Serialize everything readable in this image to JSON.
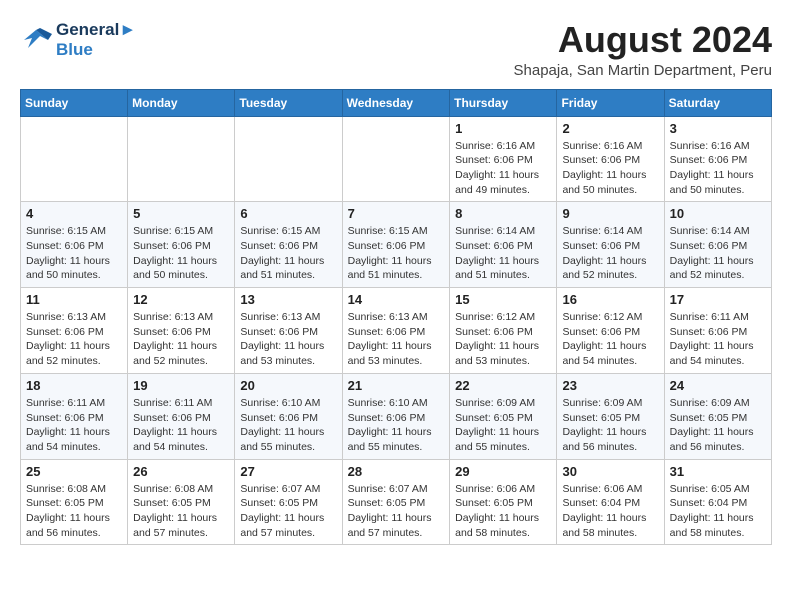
{
  "logo": {
    "line1": "General",
    "line2": "Blue"
  },
  "title": "August 2024",
  "location": "Shapaja, San Martin Department, Peru",
  "days_of_week": [
    "Sunday",
    "Monday",
    "Tuesday",
    "Wednesday",
    "Thursday",
    "Friday",
    "Saturday"
  ],
  "weeks": [
    [
      {
        "day": "",
        "info": ""
      },
      {
        "day": "",
        "info": ""
      },
      {
        "day": "",
        "info": ""
      },
      {
        "day": "",
        "info": ""
      },
      {
        "day": "1",
        "info": "Sunrise: 6:16 AM\nSunset: 6:06 PM\nDaylight: 11 hours and 49 minutes."
      },
      {
        "day": "2",
        "info": "Sunrise: 6:16 AM\nSunset: 6:06 PM\nDaylight: 11 hours and 50 minutes."
      },
      {
        "day": "3",
        "info": "Sunrise: 6:16 AM\nSunset: 6:06 PM\nDaylight: 11 hours and 50 minutes."
      }
    ],
    [
      {
        "day": "4",
        "info": "Sunrise: 6:15 AM\nSunset: 6:06 PM\nDaylight: 11 hours and 50 minutes."
      },
      {
        "day": "5",
        "info": "Sunrise: 6:15 AM\nSunset: 6:06 PM\nDaylight: 11 hours and 50 minutes."
      },
      {
        "day": "6",
        "info": "Sunrise: 6:15 AM\nSunset: 6:06 PM\nDaylight: 11 hours and 51 minutes."
      },
      {
        "day": "7",
        "info": "Sunrise: 6:15 AM\nSunset: 6:06 PM\nDaylight: 11 hours and 51 minutes."
      },
      {
        "day": "8",
        "info": "Sunrise: 6:14 AM\nSunset: 6:06 PM\nDaylight: 11 hours and 51 minutes."
      },
      {
        "day": "9",
        "info": "Sunrise: 6:14 AM\nSunset: 6:06 PM\nDaylight: 11 hours and 52 minutes."
      },
      {
        "day": "10",
        "info": "Sunrise: 6:14 AM\nSunset: 6:06 PM\nDaylight: 11 hours and 52 minutes."
      }
    ],
    [
      {
        "day": "11",
        "info": "Sunrise: 6:13 AM\nSunset: 6:06 PM\nDaylight: 11 hours and 52 minutes."
      },
      {
        "day": "12",
        "info": "Sunrise: 6:13 AM\nSunset: 6:06 PM\nDaylight: 11 hours and 52 minutes."
      },
      {
        "day": "13",
        "info": "Sunrise: 6:13 AM\nSunset: 6:06 PM\nDaylight: 11 hours and 53 minutes."
      },
      {
        "day": "14",
        "info": "Sunrise: 6:13 AM\nSunset: 6:06 PM\nDaylight: 11 hours and 53 minutes."
      },
      {
        "day": "15",
        "info": "Sunrise: 6:12 AM\nSunset: 6:06 PM\nDaylight: 11 hours and 53 minutes."
      },
      {
        "day": "16",
        "info": "Sunrise: 6:12 AM\nSunset: 6:06 PM\nDaylight: 11 hours and 54 minutes."
      },
      {
        "day": "17",
        "info": "Sunrise: 6:11 AM\nSunset: 6:06 PM\nDaylight: 11 hours and 54 minutes."
      }
    ],
    [
      {
        "day": "18",
        "info": "Sunrise: 6:11 AM\nSunset: 6:06 PM\nDaylight: 11 hours and 54 minutes."
      },
      {
        "day": "19",
        "info": "Sunrise: 6:11 AM\nSunset: 6:06 PM\nDaylight: 11 hours and 54 minutes."
      },
      {
        "day": "20",
        "info": "Sunrise: 6:10 AM\nSunset: 6:06 PM\nDaylight: 11 hours and 55 minutes."
      },
      {
        "day": "21",
        "info": "Sunrise: 6:10 AM\nSunset: 6:06 PM\nDaylight: 11 hours and 55 minutes."
      },
      {
        "day": "22",
        "info": "Sunrise: 6:09 AM\nSunset: 6:05 PM\nDaylight: 11 hours and 55 minutes."
      },
      {
        "day": "23",
        "info": "Sunrise: 6:09 AM\nSunset: 6:05 PM\nDaylight: 11 hours and 56 minutes."
      },
      {
        "day": "24",
        "info": "Sunrise: 6:09 AM\nSunset: 6:05 PM\nDaylight: 11 hours and 56 minutes."
      }
    ],
    [
      {
        "day": "25",
        "info": "Sunrise: 6:08 AM\nSunset: 6:05 PM\nDaylight: 11 hours and 56 minutes."
      },
      {
        "day": "26",
        "info": "Sunrise: 6:08 AM\nSunset: 6:05 PM\nDaylight: 11 hours and 57 minutes."
      },
      {
        "day": "27",
        "info": "Sunrise: 6:07 AM\nSunset: 6:05 PM\nDaylight: 11 hours and 57 minutes."
      },
      {
        "day": "28",
        "info": "Sunrise: 6:07 AM\nSunset: 6:05 PM\nDaylight: 11 hours and 57 minutes."
      },
      {
        "day": "29",
        "info": "Sunrise: 6:06 AM\nSunset: 6:05 PM\nDaylight: 11 hours and 58 minutes."
      },
      {
        "day": "30",
        "info": "Sunrise: 6:06 AM\nSunset: 6:04 PM\nDaylight: 11 hours and 58 minutes."
      },
      {
        "day": "31",
        "info": "Sunrise: 6:05 AM\nSunset: 6:04 PM\nDaylight: 11 hours and 58 minutes."
      }
    ]
  ]
}
